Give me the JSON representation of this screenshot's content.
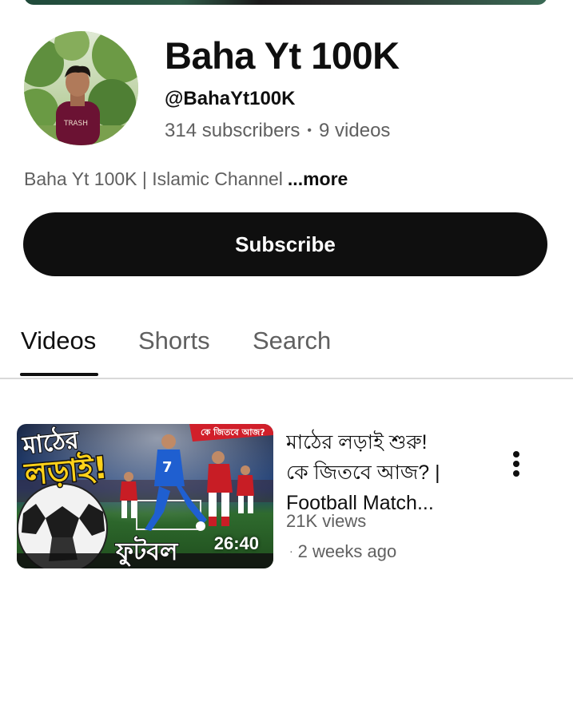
{
  "channel": {
    "name": "Baha Yt 100K",
    "handle": "@BahaYt100K",
    "subscribers": "314 subscribers",
    "videos_count": "9 videos",
    "stats_separator": "•",
    "description": "Baha Yt 100K | Islamic Channel",
    "more_label": "...more",
    "avatar_icon": "avatar"
  },
  "subscribe": {
    "label": "Subscribe",
    "bg_color": "#0f0f0f",
    "text_color": "#ffffff"
  },
  "tabs": [
    {
      "label": "Videos",
      "active": true
    },
    {
      "label": "Shorts",
      "active": false
    },
    {
      "label": "Search",
      "active": false
    }
  ],
  "videos": [
    {
      "title_lines": [
        "মাঠের লড়াই শুরু!",
        "কে জিতবে আজ? |",
        "Football Match..."
      ],
      "views": "21K views",
      "age_separator": "·",
      "age": "2 weeks ago",
      "duration": "26:40",
      "thumbnail_text": {
        "top": "মাঠের",
        "main": "লড়াই!",
        "badge": "কে জিতবে আজ?",
        "bottom": "ফুটবল"
      },
      "menu_icon": "more-vert-icon"
    }
  ]
}
